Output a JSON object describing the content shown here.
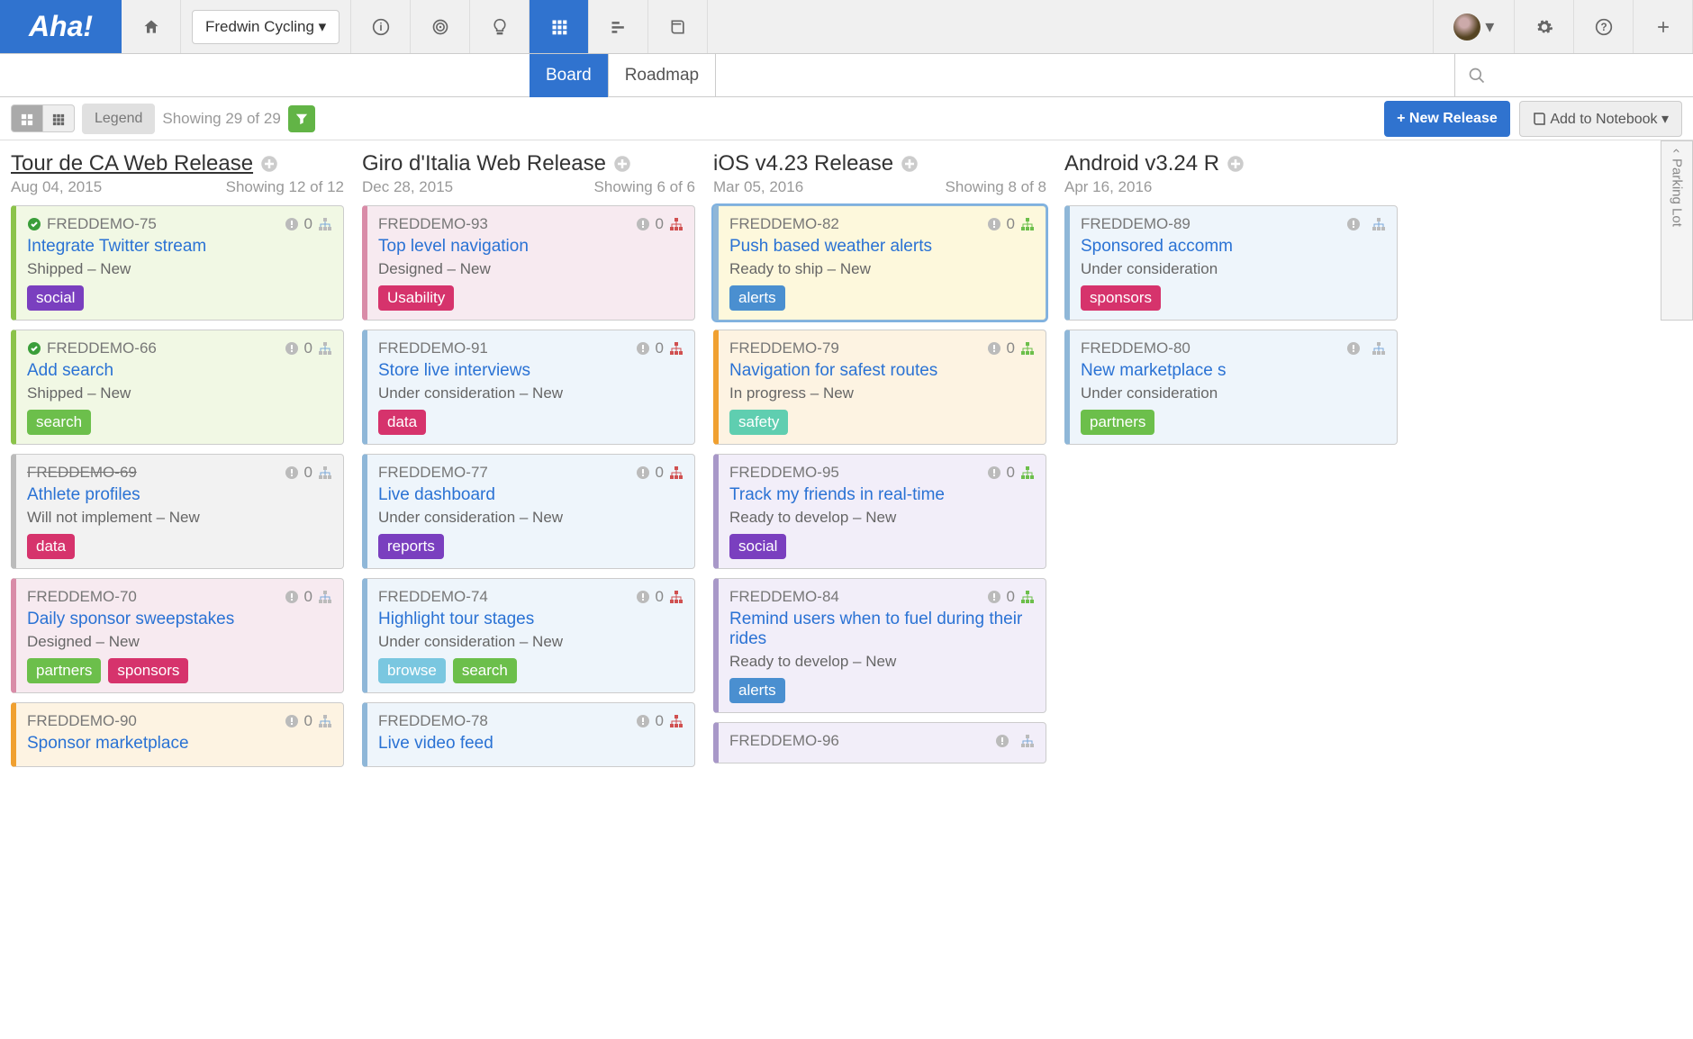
{
  "app": {
    "logo": "Aha!"
  },
  "product_selector": "Fredwin Cycling",
  "subtabs": {
    "board": "Board",
    "roadmap": "Roadmap"
  },
  "toolbar": {
    "legend": "Legend",
    "showing": "Showing 29 of 29",
    "new_release": "New Release",
    "add_notebook": "Add to Notebook"
  },
  "parking_lot": "Parking Lot",
  "columns": [
    {
      "title": "Tour de CA Web Release",
      "underline": true,
      "date": "Aug 04, 2015",
      "showing": "Showing 12 of 12",
      "cards": [
        {
          "id": "FREDDEMO-75",
          "check": true,
          "count": "0",
          "sitemap": "blue",
          "title": "Integrate Twitter stream",
          "status": "Shipped – New",
          "tags": [
            {
              "t": "social",
              "c": "t-purple"
            }
          ],
          "cls": "c-green"
        },
        {
          "id": "FREDDEMO-66",
          "check": true,
          "count": "0",
          "sitemap": "blue",
          "title": "Add search",
          "status": "Shipped – New",
          "tags": [
            {
              "t": "search",
              "c": "t-green"
            }
          ],
          "cls": "c-green"
        },
        {
          "id": "FREDDEMO-69",
          "strike": true,
          "count": "0",
          "sitemap": "blue",
          "title": "Athlete profiles",
          "status": "Will not implement – New",
          "tags": [
            {
              "t": "data",
              "c": "t-pink"
            }
          ],
          "cls": "c-grey"
        },
        {
          "id": "FREDDEMO-70",
          "count": "0",
          "sitemap": "blue",
          "title": "Daily sponsor sweepstakes",
          "status": "Designed – New",
          "tags": [
            {
              "t": "partners",
              "c": "t-green"
            },
            {
              "t": "sponsors",
              "c": "t-pink"
            }
          ],
          "cls": "c-pink"
        },
        {
          "id": "FREDDEMO-90",
          "count": "0",
          "sitemap": "blue",
          "title": "Sponsor marketplace",
          "status": "",
          "tags": [],
          "cls": "c-orange"
        }
      ]
    },
    {
      "title": "Giro d'Italia Web Release",
      "date": "Dec 28, 2015",
      "showing": "Showing 6 of 6",
      "cards": [
        {
          "id": "FREDDEMO-93",
          "count": "0",
          "sitemap": "red",
          "title": "Top level navigation",
          "status": "Designed – New",
          "tags": [
            {
              "t": "Usability",
              "c": "t-pink"
            }
          ],
          "cls": "c-pink"
        },
        {
          "id": "FREDDEMO-91",
          "count": "0",
          "sitemap": "red",
          "title": "Store live interviews",
          "status": "Under consideration – New",
          "tags": [
            {
              "t": "data",
              "c": "t-pink"
            }
          ],
          "cls": "c-lblue"
        },
        {
          "id": "FREDDEMO-77",
          "count": "0",
          "sitemap": "red",
          "title": "Live dashboard",
          "status": "Under consideration – New",
          "tags": [
            {
              "t": "reports",
              "c": "t-purple"
            }
          ],
          "cls": "c-lblue"
        },
        {
          "id": "FREDDEMO-74",
          "count": "0",
          "sitemap": "red",
          "title": "Highlight tour stages",
          "status": "Under consideration – New",
          "tags": [
            {
              "t": "browse",
              "c": "t-cyan"
            },
            {
              "t": "search",
              "c": "t-green"
            }
          ],
          "cls": "c-lblue"
        },
        {
          "id": "FREDDEMO-78",
          "count": "0",
          "sitemap": "red",
          "title": "Live video feed",
          "status": "",
          "tags": [],
          "cls": "c-lblue"
        }
      ]
    },
    {
      "title": "iOS v4.23 Release",
      "date": "Mar 05, 2016",
      "showing": "Showing 8 of 8",
      "cards": [
        {
          "id": "FREDDEMO-82",
          "count": "0",
          "sitemap": "grn",
          "title": "Push based weather alerts",
          "status": "Ready to ship – New",
          "tags": [
            {
              "t": "alerts",
              "c": "t-dblue"
            }
          ],
          "cls": "c-yellow c-border-blue"
        },
        {
          "id": "FREDDEMO-79",
          "count": "0",
          "sitemap": "grn",
          "title": "Navigation for safest routes",
          "status": "In progress – New",
          "tags": [
            {
              "t": "safety",
              "c": "t-teal"
            }
          ],
          "cls": "c-orange"
        },
        {
          "id": "FREDDEMO-95",
          "count": "0",
          "sitemap": "grn",
          "title": "Track my friends in real-time",
          "status": "Ready to develop – New",
          "tags": [
            {
              "t": "social",
              "c": "t-purple"
            }
          ],
          "cls": "c-purple"
        },
        {
          "id": "FREDDEMO-84",
          "count": "0",
          "sitemap": "grn",
          "title": "Remind users when to fuel during their rides",
          "status": "Ready to develop – New",
          "tags": [
            {
              "t": "alerts",
              "c": "t-dblue"
            }
          ],
          "cls": "c-purple"
        },
        {
          "id": "FREDDEMO-96",
          "count": "",
          "sitemap": "",
          "title": "",
          "status": "",
          "tags": [],
          "cls": "c-purple"
        }
      ]
    },
    {
      "title": "Android v3.24 R",
      "date": "Apr 16, 2016",
      "showing": "",
      "cards": [
        {
          "id": "FREDDEMO-89",
          "count": "",
          "title": "Sponsored accomm",
          "status": "Under consideration",
          "tags": [
            {
              "t": "sponsors",
              "c": "t-pink"
            }
          ],
          "cls": "c-lblue"
        },
        {
          "id": "FREDDEMO-80",
          "count": "",
          "title": "New marketplace s",
          "status": "Under consideration",
          "tags": [
            {
              "t": "partners",
              "c": "t-green"
            }
          ],
          "cls": "c-lblue"
        }
      ]
    }
  ]
}
